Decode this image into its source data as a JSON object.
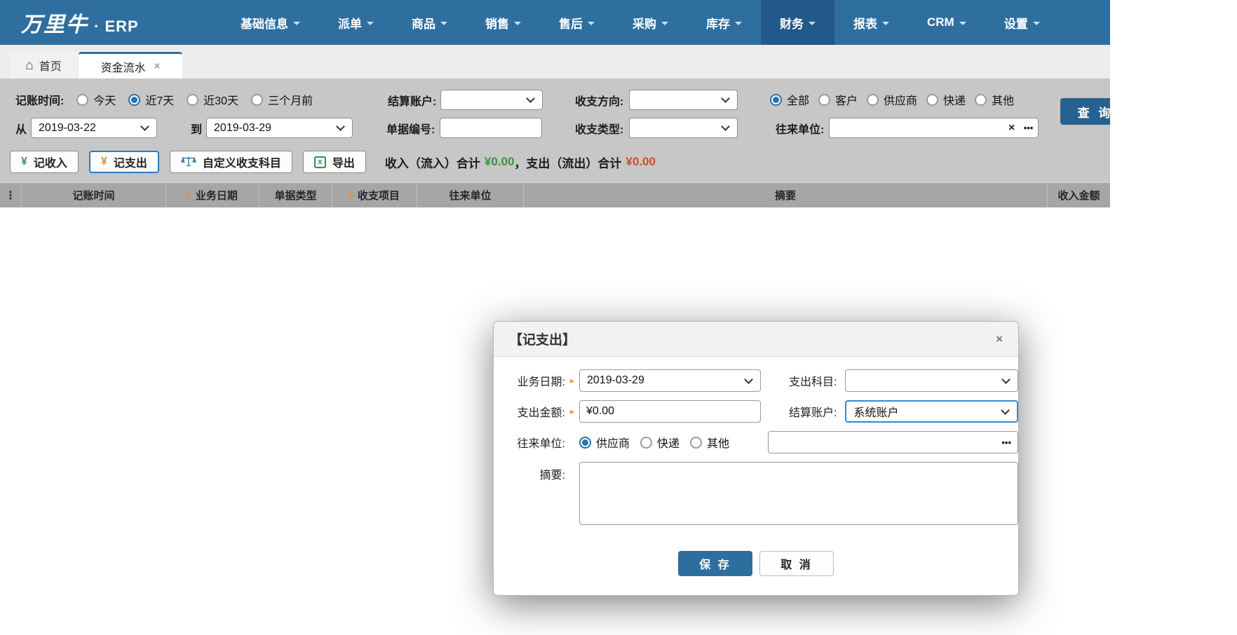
{
  "nav": {
    "logo_text": "万里牛",
    "logo_suffix": "· ERP",
    "items": [
      "基础信息",
      "派单",
      "商品",
      "销售",
      "售后",
      "采购",
      "库存",
      "财务",
      "报表",
      "CRM",
      "设置"
    ],
    "active_item": "财务"
  },
  "tabs": {
    "home": "首页",
    "active_tab": "资金流水"
  },
  "filters": {
    "time_label": "记账时间:",
    "time_options": [
      "今天",
      "近7天",
      "近30天",
      "三个月前"
    ],
    "time_selected": "近7天",
    "settle_account_label": "结算账户:",
    "settle_account_value": "",
    "direction_label": "收支方向:",
    "direction_value": "",
    "party_options": [
      "全部",
      "客户",
      "供应商",
      "快递",
      "其他"
    ],
    "party_selected": "全部",
    "from_label": "从",
    "from_value": "2019-03-22",
    "to_label": "到",
    "to_value": "2019-03-29",
    "doc_no_label": "单据编号:",
    "doc_no_value": "",
    "type_label": "收支类型:",
    "type_value": "",
    "unit_label": "往来单位:",
    "unit_value": "",
    "search_button": "查 询"
  },
  "toolbar": {
    "record_income": "记收入",
    "record_expense": "记支出",
    "custom_categories": "自定义收支科目",
    "export": "导出",
    "income_total_label": "收入（流入）合计",
    "income_total": "¥0.00",
    "separator": "，",
    "expense_total_label": "支出（流出）合计",
    "expense_total": "¥0.00"
  },
  "table": {
    "columns": [
      {
        "label": "记账时间"
      },
      {
        "label": "业务日期",
        "sortable": true
      },
      {
        "label": "单据类型"
      },
      {
        "label": "收支项目",
        "sortable": true
      },
      {
        "label": "往来单位"
      },
      {
        "label": "摘要"
      },
      {
        "label": "收入金额"
      }
    ]
  },
  "modal": {
    "title": "【记支出】",
    "fields": {
      "biz_date_label": "业务日期:",
      "biz_date_value": "2019-03-29",
      "expense_category_label": "支出科目:",
      "expense_category_value": "",
      "amount_label": "支出金额:",
      "amount_value": "¥0.00",
      "settle_label": "结算账户:",
      "settle_value": "系统账户",
      "unit_label": "往来单位:",
      "unit_options": [
        "供应商",
        "快递",
        "其他"
      ],
      "unit_selected": "供应商",
      "unit_value": "",
      "summary_label": "摘要:"
    },
    "save": "保 存",
    "cancel": "取 消"
  },
  "icons": {
    "home": "⌂",
    "tab_close": "×",
    "clear": "×",
    "ellipsis": "•••",
    "dots_vertical": "⋮",
    "sort": "▶",
    "required": "▸",
    "yen": "¥",
    "excel": "x",
    "close": "×"
  },
  "colors": {
    "nav_blue": "#2e6f9f",
    "nav_active_blue": "#23598a",
    "accent_button_blue": "#2e6e9e",
    "income_green": "#3f9140",
    "expense_red": "#d14b2b",
    "marker_orange": "#e8952f",
    "focus_border_blue": "#3c86c6"
  }
}
